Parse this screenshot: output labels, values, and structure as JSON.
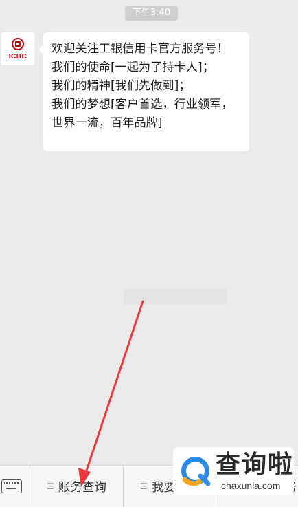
{
  "chat": {
    "timestamp": "下午3:40",
    "sender": {
      "name": "ICBC",
      "logo_text": "ICBC"
    },
    "message": {
      "lines": [
        "欢迎关注工银信用卡官方服务号！",
        "我们的使命[一起为了持卡人]；",
        "我们的精神[我们先做到]；",
        "我们的梦想[客户首选，行业领军，世界一流，百年品牌]"
      ]
    }
  },
  "menu": {
    "items": [
      {
        "label": "账务查询"
      },
      {
        "label": "我要分"
      },
      {
        "label": "务"
      }
    ]
  },
  "watermark": {
    "title": "查询啦",
    "url": "chaxunla.com"
  },
  "colors": {
    "background": "#ebebeb",
    "brand_red": "#c7000b",
    "annotation_arrow": "#e8383d",
    "watermark_blue": "#2b8ae6",
    "watermark_orange": "#f5a623"
  }
}
